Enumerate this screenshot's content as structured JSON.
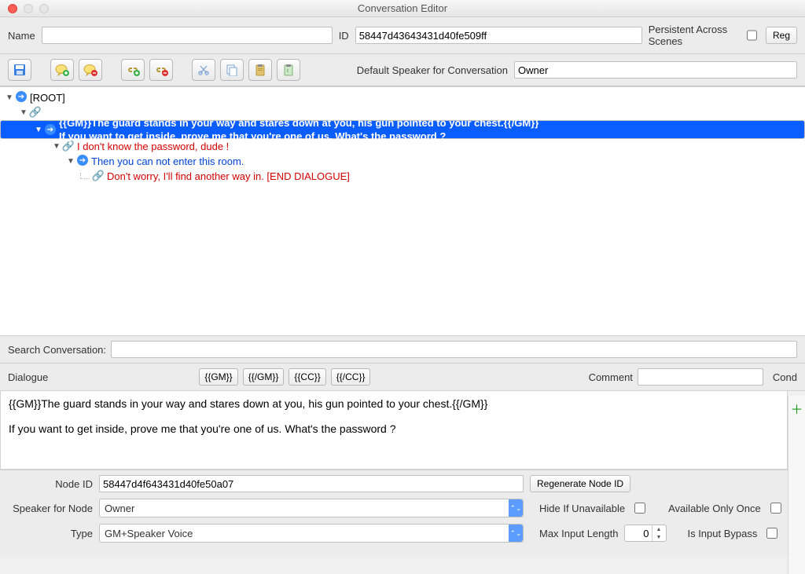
{
  "window": {
    "title": "Conversation Editor"
  },
  "toprow": {
    "name_label": "Name",
    "name_value": "",
    "id_label": "ID",
    "id_value": "58447d43643431d40fe509ff",
    "persistent_label": "Persistent Across Scenes",
    "reg_button": "Reg"
  },
  "toolbar": {
    "default_speaker_label": "Default Speaker for Conversation",
    "default_speaker_value": "Owner"
  },
  "tree": {
    "root_label": "[ROOT]",
    "n1_line1": "{{GM}}The guard stands in your way and stares down at you, his gun pointed to your chest.{{/GM}}",
    "n1_line2": "If you want to get inside, prove me that you're one of us. What's the password ?",
    "n2": "I don't know the password, dude !",
    "n3": "Then you can not enter this room.",
    "n4": "Don't worry, I'll find another way in. [END DIALOGUE]"
  },
  "search": {
    "label": "Search Conversation:",
    "value": ""
  },
  "dialogue": {
    "label": "Dialogue",
    "tags": {
      "gm_open": "{{GM}}",
      "gm_close": "{{/GM}}",
      "cc_open": "{{CC}}",
      "cc_close": "{{/CC}}"
    },
    "comment_label": "Comment",
    "comment_value": "",
    "cond_label": "Cond",
    "text": "{{GM}}The guard stands in your way and stares down at you, his gun pointed to your chest.{{/GM}}\n\nIf you want to get inside, prove me that you're one of us. What's the password ?"
  },
  "node": {
    "nodeid_label": "Node ID",
    "nodeid_value": "58447d4f643431d40fe50a07",
    "regen_btn": "Regenerate Node ID",
    "speaker_label": "Speaker for Node",
    "speaker_value": "Owner",
    "hide_label": "Hide If Unavailable",
    "avail_label": "Available Only Once",
    "type_label": "Type",
    "type_value": "GM+Speaker Voice",
    "maxinput_label": "Max Input Length",
    "maxinput_value": "0",
    "bypass_label": "Is Input Bypass"
  }
}
